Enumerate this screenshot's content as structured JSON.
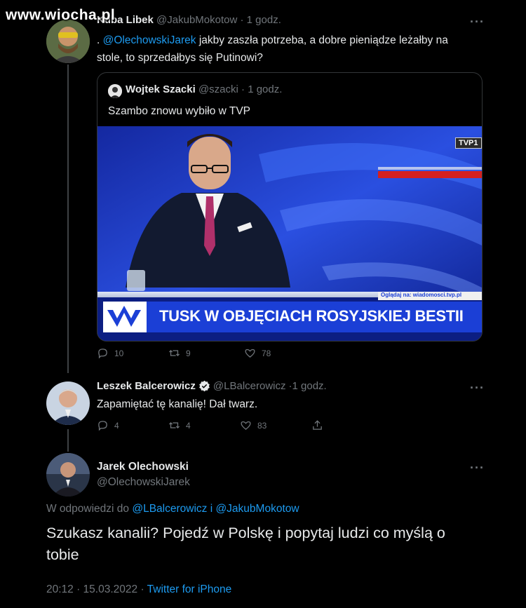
{
  "watermark": "www.wiocha.pl",
  "tweet1": {
    "name": "Kuba Libek",
    "handle": "@JakubMokotow",
    "time": "1 godz.",
    "prefix": ". ",
    "mention": "@OlechowskiJarek",
    "text_line1": " jakby zaszła potrzeba, a dobre pieniądze leżałby na",
    "text_line2": "stole, to sprzedałbys się Putinowi?",
    "quote": {
      "name": "Wojtek Szacki",
      "handle": "@szacki",
      "time": "1 godz.",
      "text": "Szambo znowu wybiło w TVP",
      "image": {
        "headline": "TUSK W OBJĘCIACH ROSYJSKIEJ BESTII",
        "website": "Oglądaj na: wiadomosci.tvp.pl",
        "channel_logo": "TVP1"
      }
    },
    "replies": "10",
    "retweets": "9",
    "likes": "78"
  },
  "tweet2": {
    "name": "Leszek Balcerowicz",
    "verified": true,
    "handle": "@LBalcerowicz",
    "time": "1 godz.",
    "text": "Zapamiętać tę kanalię! Dał twarz.",
    "replies": "4",
    "retweets": "4",
    "likes": "83"
  },
  "tweet3": {
    "name": "Jarek Olechowski",
    "handle": "@OlechowskiJarek",
    "reply_prefix": "W odpowiedzi do ",
    "reply_to": "@LBalcerowicz i @JakubMokotow",
    "text_line1": "Szukasz kanalii? Pojedź w Polskę i popytaj ludzi co myślą o",
    "text_line2": "tobie",
    "timestamp": "20:12 · 15.03.2022 · ",
    "source": "Twitter for iPhone"
  },
  "separator": " · ",
  "more_glyph": "···",
  "colors": {
    "accent": "#1d9bf0",
    "muted": "#71767b",
    "background": "#000000",
    "text": "#e7e9ea"
  }
}
